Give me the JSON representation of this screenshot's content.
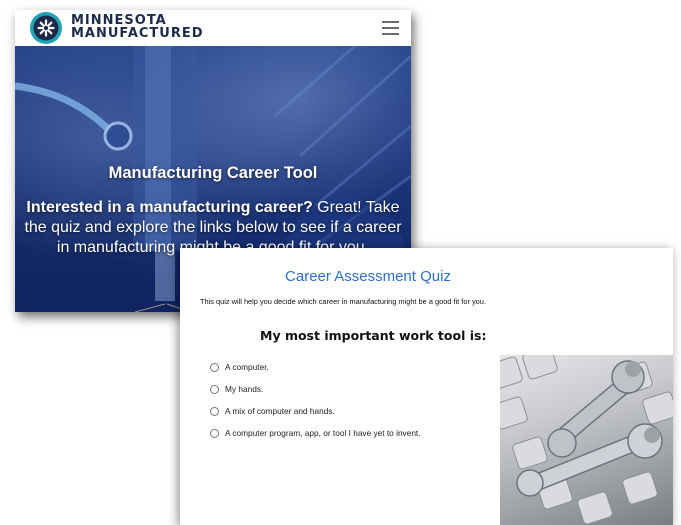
{
  "logo": {
    "line1": "MINNESOTA",
    "line2": "MANUFACTURED"
  },
  "hero": {
    "title": "Manufacturing Career Tool",
    "body_bold": "Interested in a manufacturing career?",
    "body_rest": " Great! Take the quiz and explore the links below to see if a career in manufacturing might be a good fit for you."
  },
  "quiz": {
    "title": "Career Assessment Quiz",
    "intro": "This quiz will help you decide which career in manufacturing might be a good fit for you.",
    "question": "My most important work tool is:",
    "options": [
      "A computer.",
      "My hands.",
      "A mix of computer and hands.",
      "A computer program, app, or tool I have yet to invent."
    ]
  },
  "colors": {
    "accent": "#2f6fc9",
    "hero_blue": "#173072",
    "logo_teal": "#20a3b5"
  },
  "icons": {
    "menu": "hamburger-menu-icon",
    "logo": "logo-icon",
    "radio": "radio-unchecked-icon"
  }
}
